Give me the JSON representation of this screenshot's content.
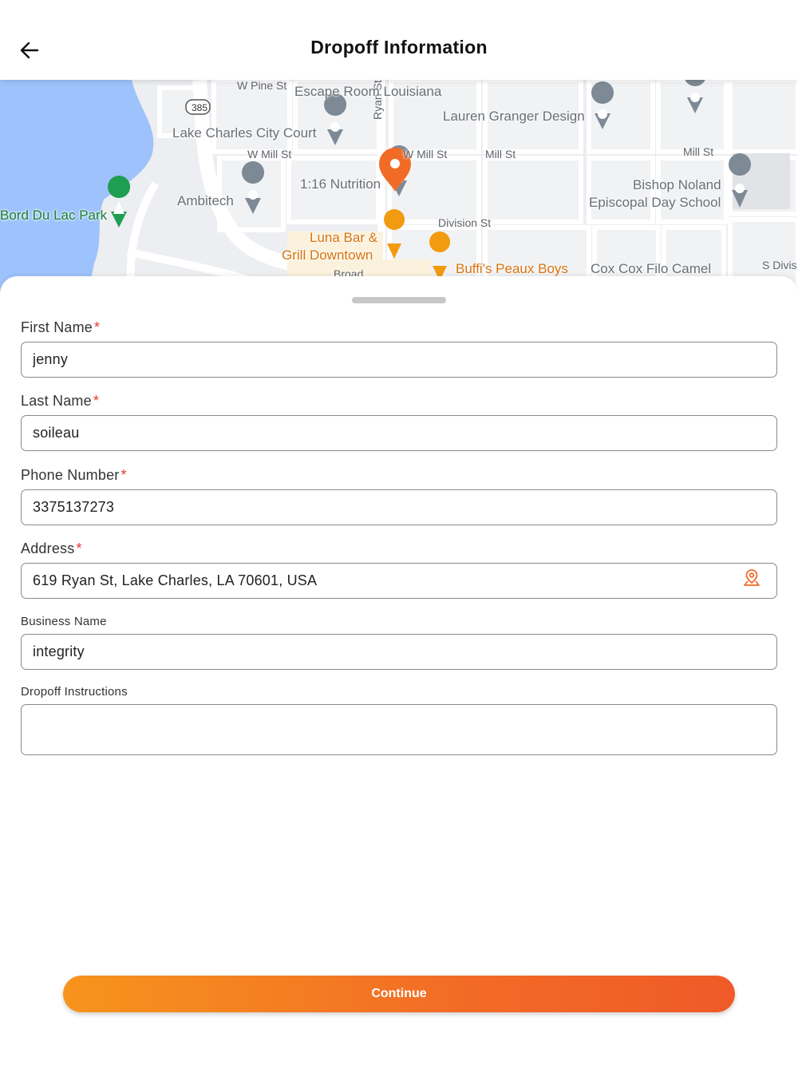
{
  "header": {
    "title": "Dropoff Information",
    "back_icon": "arrow-left-icon"
  },
  "map": {
    "streets": [
      "W Pine St",
      "W Mill St",
      "W Mill St",
      "Mill St",
      "Mill St",
      "Division St",
      "Ryan St",
      "S Divis",
      "385",
      "Broad"
    ],
    "pois": {
      "escape_room": "Escape Room Louisiana",
      "lauren_granger": "Lauren Granger Design",
      "city_court": "Lake Charles City Court",
      "nutrition": "1:16 Nutrition",
      "ambitech": "Ambitech",
      "bord_du_lac": "Bord Du Lac Park",
      "bishop_noland_1": "Bishop Noland",
      "bishop_noland_2": "Episcopal Day School",
      "luna_bar_1": "Luna Bar &",
      "luna_bar_2": "Grill Downtown",
      "buffis": "Buffi's Peaux Boys",
      "cox": "Cox Cox Filo Camel"
    },
    "colors": {
      "water": "#9ec2fb",
      "accent": "#f26b26",
      "park": "#188038"
    }
  },
  "form": {
    "first_name": {
      "label": "First Name",
      "required": "*",
      "value": "jenny"
    },
    "last_name": {
      "label": "Last Name",
      "required": "*",
      "value": "soileau"
    },
    "phone": {
      "label": "Phone Number",
      "required": "*",
      "value": "3375137273"
    },
    "address": {
      "label": "Address",
      "required": "*",
      "value": "619 Ryan St, Lake Charles, LA 70601, USA",
      "icon": "map-pin-icon"
    },
    "business": {
      "label": "Business Name",
      "value": "integrity"
    },
    "instructions": {
      "label": "Dropoff Instructions",
      "value": ""
    }
  },
  "actions": {
    "continue_label": "Continue"
  }
}
